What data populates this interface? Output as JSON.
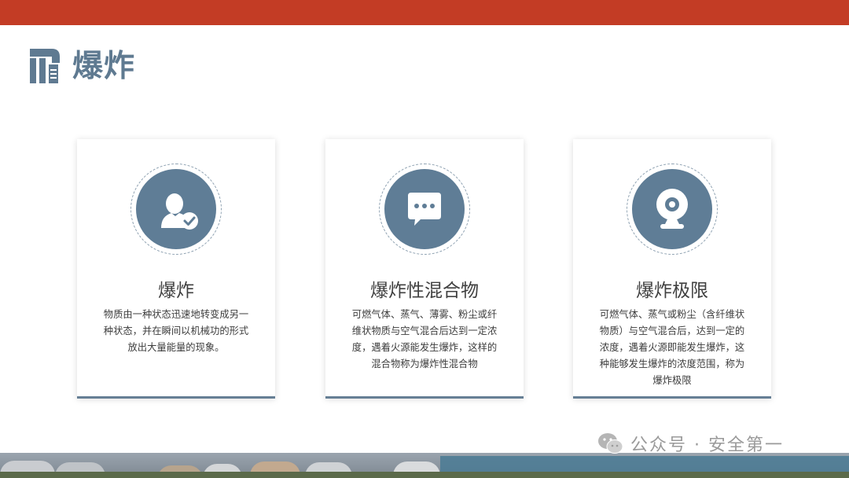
{
  "header": {
    "title": "爆炸"
  },
  "cards": [
    {
      "icon": "user-check-icon",
      "title": "爆炸",
      "lines": [
        "物质由一种状态迅速地转变成另一",
        "种状态，并在瞬间以机械功的形式",
        "放出大量能量的现象。"
      ]
    },
    {
      "icon": "chat-bubble-icon",
      "title": "爆炸性混合物",
      "lines": [
        "可燃气体、蒸气、薄雾、粉尘或纤",
        "维状物质与空气混合后达到一定浓",
        "度，遇着火源能发生爆炸，这样的",
        "混合物称为爆炸性混合物"
      ]
    },
    {
      "icon": "webcam-icon",
      "title": "爆炸极限",
      "lines": [
        "可燃气体、蒸气或粉尘（含纤维状",
        "物质）与空气混合后，达到一定的",
        "浓度，遇着火源即能发生爆炸，这",
        "种能够发生爆炸的浓度范围，称为",
        "爆炸极限"
      ]
    }
  ],
  "watermark": {
    "text": "公众号 · 安全第一"
  },
  "colors": {
    "top_bar": "#c33c25",
    "accent": "#5f7d96",
    "title_text": "#5f7a91"
  }
}
